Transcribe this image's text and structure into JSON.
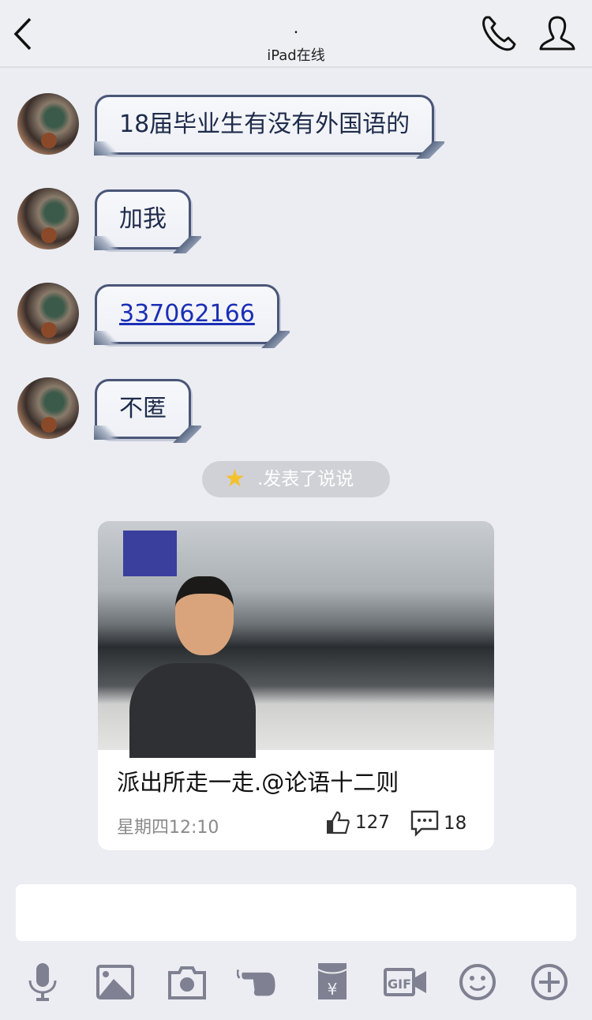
{
  "header": {
    "title": ".",
    "subtitle": "iPad在线"
  },
  "messages": [
    {
      "text": "18届毕业生有没有外国语的"
    },
    {
      "text": "加我"
    },
    {
      "text": "337062166",
      "is_link": true
    },
    {
      "text": "不匿"
    }
  ],
  "notice": {
    "text": ".发表了说说",
    "icon": "qzone-star-icon"
  },
  "post": {
    "caption": "派出所走一走.@论语十二则",
    "time": "星期四12:10",
    "likes": "127",
    "comments": "18"
  },
  "toolbar": [
    "mic-icon",
    "image-icon",
    "camera-icon",
    "poke-icon",
    "red-packet-icon",
    "gif-icon",
    "emoji-icon",
    "plus-icon"
  ],
  "colors": {
    "background": "#ebedf2",
    "bubble_border": "#4a5677",
    "icon": "#7f8091",
    "link": "#1b2fb5"
  }
}
